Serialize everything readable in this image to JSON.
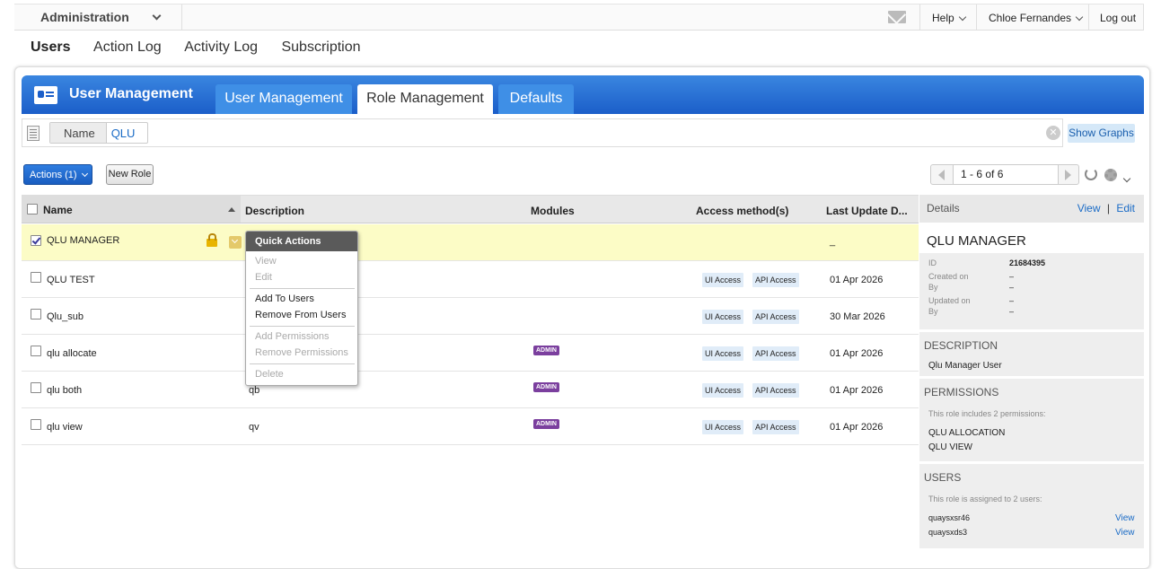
{
  "topbar": {
    "admin_label": "Administration",
    "help_label": "Help",
    "user_label": "Chloe Fernandes",
    "logout_label": "Log out"
  },
  "nav": {
    "items": [
      "Users",
      "Action Log",
      "Activity Log",
      "Subscription"
    ],
    "active": "Users"
  },
  "header": {
    "title": "User Management",
    "tabs": [
      "User Management",
      "Role Management",
      "Defaults"
    ],
    "active_tab": "Role Management"
  },
  "filter": {
    "key": "Name",
    "value": "QLU",
    "show_graphs": "Show Graphs"
  },
  "toolbar": {
    "actions_label": "Actions (1)",
    "new_role_label": "New Role",
    "pager_text": "1 - 6 of 6"
  },
  "table": {
    "columns": [
      "Name",
      "Description",
      "Modules",
      "Access method(s)",
      "Last Update D..."
    ],
    "rows": [
      {
        "name": "QLU MANAGER",
        "description": "",
        "module": "",
        "access": [],
        "date": "_",
        "checked": true
      },
      {
        "name": "QLU TEST",
        "description": "",
        "module": "",
        "access": [
          "UI Access",
          "API Access"
        ],
        "date": "01 Apr 2026",
        "checked": false
      },
      {
        "name": "Qlu_sub",
        "description": "",
        "module": "",
        "access": [
          "UI Access",
          "API Access"
        ],
        "date": "30 Mar 2026",
        "checked": false
      },
      {
        "name": "qlu allocate",
        "description": "",
        "module": "ADMIN",
        "access": [
          "UI Access",
          "API Access"
        ],
        "date": "01 Apr 2026",
        "checked": false
      },
      {
        "name": "qlu both",
        "description": "qb",
        "module": "ADMIN",
        "access": [
          "UI Access",
          "API Access"
        ],
        "date": "01 Apr 2026",
        "checked": false
      },
      {
        "name": "qlu view",
        "description": "qv",
        "module": "ADMIN",
        "access": [
          "UI Access",
          "API Access"
        ],
        "date": "01 Apr 2026",
        "checked": false
      }
    ]
  },
  "quick_actions": {
    "title": "Quick Actions",
    "view": "View",
    "edit": "Edit",
    "add_users": "Add To Users",
    "remove_users": "Remove From Users",
    "add_permissions": "Add Permissions",
    "remove_permissions": "Remove Permissions",
    "delete": "Delete"
  },
  "details": {
    "header": "Details",
    "view_link": "View",
    "sep": "|",
    "edit_link": "Edit",
    "title": "QLU MANAGER",
    "id_label": "ID",
    "id_value": "21684395",
    "created_label": "Created on",
    "created_value": "–",
    "by_label": "By",
    "by_value": "–",
    "updated_label": "Updated on",
    "updated_value": "–",
    "by2_label": "By",
    "by2_value": "–",
    "description_header": "DESCRIPTION",
    "description": "Qlu Manager User",
    "permissions_header": "PERMISSIONS",
    "permissions_note": "This role includes 2 permissions:",
    "permissions": [
      "QLU ALLOCATION",
      "QLU VIEW"
    ],
    "users_header": "USERS",
    "users_note": "This role is assigned to 2 users:",
    "users": [
      "quaysxsr46",
      "quaysxds3"
    ],
    "user_view": "View"
  }
}
